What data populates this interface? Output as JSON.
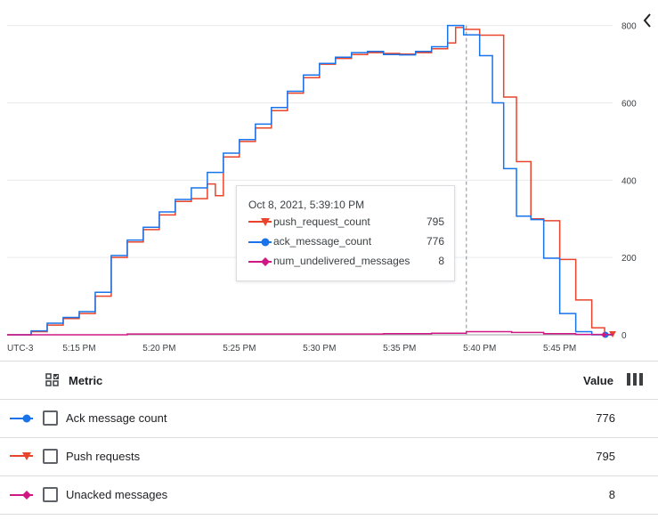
{
  "chart_data": {
    "type": "line",
    "timezone_label": "UTC-3",
    "x_tick_labels": [
      "5:15 PM",
      "5:20 PM",
      "5:25 PM",
      "5:30 PM",
      "5:35 PM",
      "5:40 PM",
      "5:45 PM"
    ],
    "x_tick_minutes": [
      15,
      20,
      25,
      30,
      35,
      40,
      45
    ],
    "xlim_minutes": [
      10.5,
      48.3
    ],
    "y_ticks": [
      0,
      200,
      400,
      600,
      800
    ],
    "ylim": [
      0,
      820
    ],
    "y_axis_side": "right",
    "grid": true,
    "hover_x_minute": 39.17,
    "series": [
      {
        "name": "push_request_count",
        "color": "#e8452c",
        "marker": "triangle-down",
        "x": [
          10.5,
          12,
          13,
          14,
          15,
          16,
          17,
          18,
          19,
          20,
          21,
          22,
          23,
          23.5,
          24,
          25,
          26,
          27,
          28,
          29,
          30,
          31,
          32,
          33,
          34,
          35,
          36,
          37,
          38,
          38.5,
          39,
          40,
          40.8,
          41.5,
          42.3,
          43.2,
          44,
          45,
          46,
          47,
          47.8,
          48.3
        ],
        "y": [
          0,
          8,
          25,
          42,
          55,
          100,
          200,
          240,
          272,
          310,
          345,
          352,
          390,
          360,
          460,
          500,
          535,
          580,
          625,
          665,
          700,
          715,
          725,
          730,
          728,
          726,
          730,
          740,
          755,
          795,
          790,
          775,
          775,
          615,
          448,
          300,
          295,
          195,
          90,
          18,
          0,
          0
        ]
      },
      {
        "name": "ack_message_count",
        "color": "#1a73e8",
        "marker": "circle",
        "x": [
          10.5,
          12,
          13,
          14,
          15,
          16,
          17,
          18,
          19,
          20,
          21,
          22,
          23,
          24,
          25,
          26,
          27,
          28,
          29,
          30,
          31,
          32,
          33,
          34,
          35,
          36,
          37,
          38,
          38.5,
          39,
          40,
          40.8,
          41.5,
          42.3,
          43.2,
          44,
          45,
          46,
          47,
          48.3
        ],
        "y": [
          0,
          10,
          30,
          45,
          60,
          110,
          205,
          245,
          278,
          318,
          350,
          380,
          420,
          470,
          505,
          545,
          588,
          630,
          672,
          702,
          718,
          730,
          733,
          725,
          724,
          733,
          745,
          800,
          800,
          776,
          722,
          600,
          430,
          307,
          298,
          198,
          55,
          8,
          0,
          0
        ]
      },
      {
        "name": "num_undelivered_messages",
        "color": "#d01884",
        "marker": "diamond",
        "x": [
          10.5,
          14,
          18,
          22,
          26,
          30,
          34,
          37,
          39.17,
          42,
          44,
          46,
          48.3
        ],
        "y": [
          0,
          0,
          2,
          2,
          2,
          2,
          3,
          4,
          8,
          6,
          3,
          1,
          0
        ]
      }
    ]
  },
  "ui": {
    "collapse_icon": "chevron-left-icon",
    "tooltip": {
      "title": "Oct 8, 2021, 5:39:10 PM",
      "rows": [
        {
          "name": "push_request_count",
          "value": "795"
        },
        {
          "name": "ack_message_count",
          "value": "776"
        },
        {
          "name": "num_undelivered_messages",
          "value": "8"
        }
      ]
    },
    "table": {
      "metric_header": "Metric",
      "value_header": "Value",
      "select_icon": "select-all-icon",
      "columns_icon": "column-view-icon",
      "rows": [
        {
          "label": "Ack message count",
          "value": "776",
          "color": "#1a73e8",
          "marker": "circle"
        },
        {
          "label": "Push requests",
          "value": "795",
          "color": "#e8452c",
          "marker": "triangle-down"
        },
        {
          "label": "Unacked messages",
          "value": "8",
          "color": "#d01884",
          "marker": "diamond"
        }
      ]
    }
  }
}
